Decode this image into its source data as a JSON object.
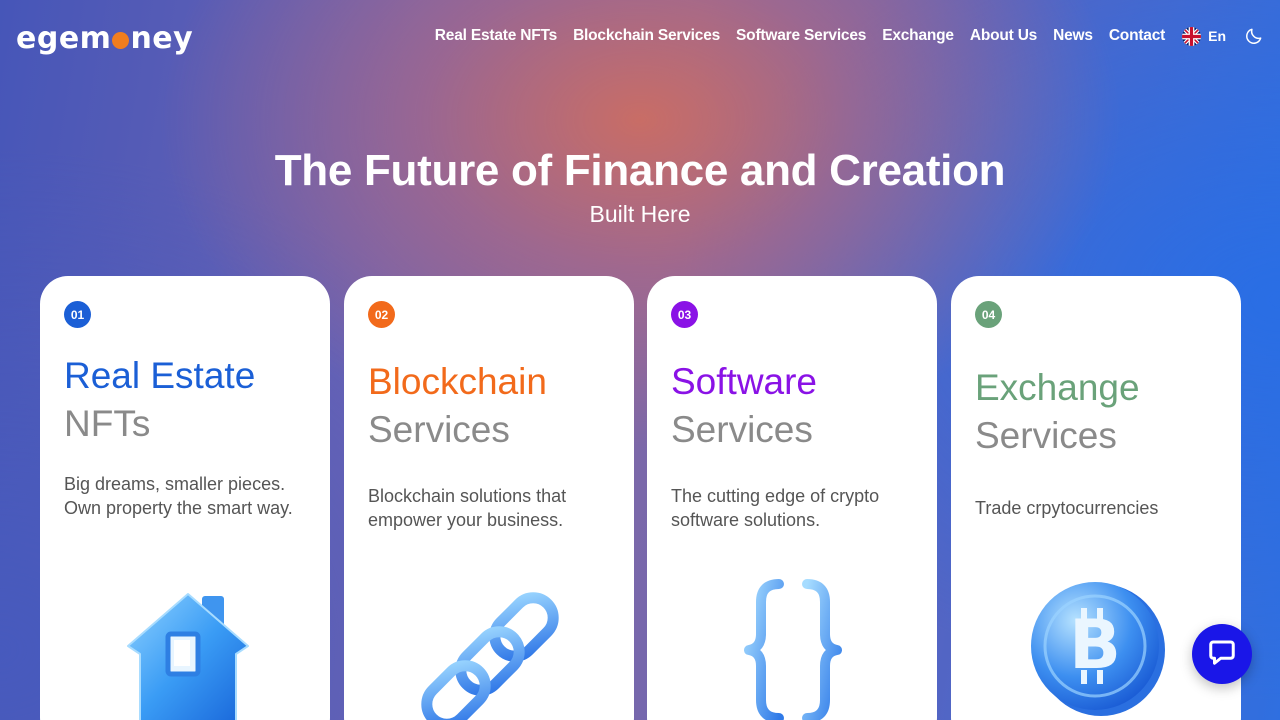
{
  "logo": {
    "prefix": "eg",
    "middle": "em",
    "suffix": "ney",
    "dot_color": "#f07d1f"
  },
  "nav": {
    "items": [
      "Real Estate NFTs",
      "Blockchain Services",
      "Software Services",
      "Exchange",
      "About Us",
      "News",
      "Contact"
    ],
    "language": "En",
    "language_icon": "uk-flag-icon",
    "theme_icon": "moon-icon"
  },
  "hero": {
    "title": "The Future of Finance and Creation",
    "subtitle": "Built Here"
  },
  "cards": [
    {
      "number": "01",
      "title_accent": "Real Estate",
      "title_rest": "NFTs",
      "description": "Big dreams, smaller pieces. Own property the smart way.",
      "accent_color": "#1b5fd6",
      "icon": "house-icon"
    },
    {
      "number": "02",
      "title_accent": "Blockchain",
      "title_rest": "Services",
      "description": "Blockchain solutions that empower your business.",
      "accent_color": "#f26a1b",
      "icon": "chain-icon"
    },
    {
      "number": "03",
      "title_accent": "Software",
      "title_rest": "Services",
      "description": "The cutting edge of crypto software solutions.",
      "accent_color": "#8a12e6",
      "icon": "curly-braces-icon"
    },
    {
      "number": "04",
      "title_accent": "Exchange",
      "title_rest": "Services",
      "description": "Trade crpytocurrencies",
      "accent_color": "#6aa27a",
      "icon": "bitcoin-coin-icon"
    }
  ],
  "chat": {
    "icon": "chat-bubble-icon",
    "color": "#1a16e8"
  }
}
